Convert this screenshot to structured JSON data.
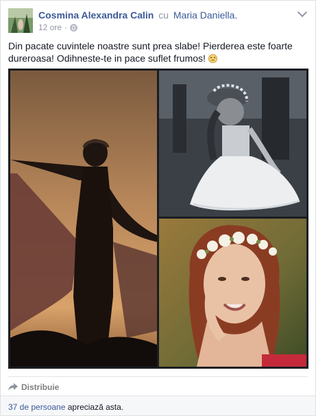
{
  "post": {
    "author": "Cosmina Alexandra Calin",
    "connector": "cu",
    "tagged": "Maria Daniella.",
    "time": "12 ore",
    "separator": "·",
    "text": "Din pacate cuvintele noastre sunt prea slabe! Pierderea este foarte dureroasa! Odihneste-te in pace suflet frumos!",
    "emoji": "smile-emoji"
  },
  "actions": {
    "share_label": "Distribuie"
  },
  "likes": {
    "count_text": "37 de persoane",
    "suffix": " apreciază asta."
  },
  "icons": {
    "visibility": "globe-icon",
    "menu": "chevron-down-icon",
    "share": "share-arrow-icon"
  },
  "colors": {
    "link": "#3b5998",
    "muted": "#9197a3",
    "footer_bg": "#f6f7f9"
  }
}
